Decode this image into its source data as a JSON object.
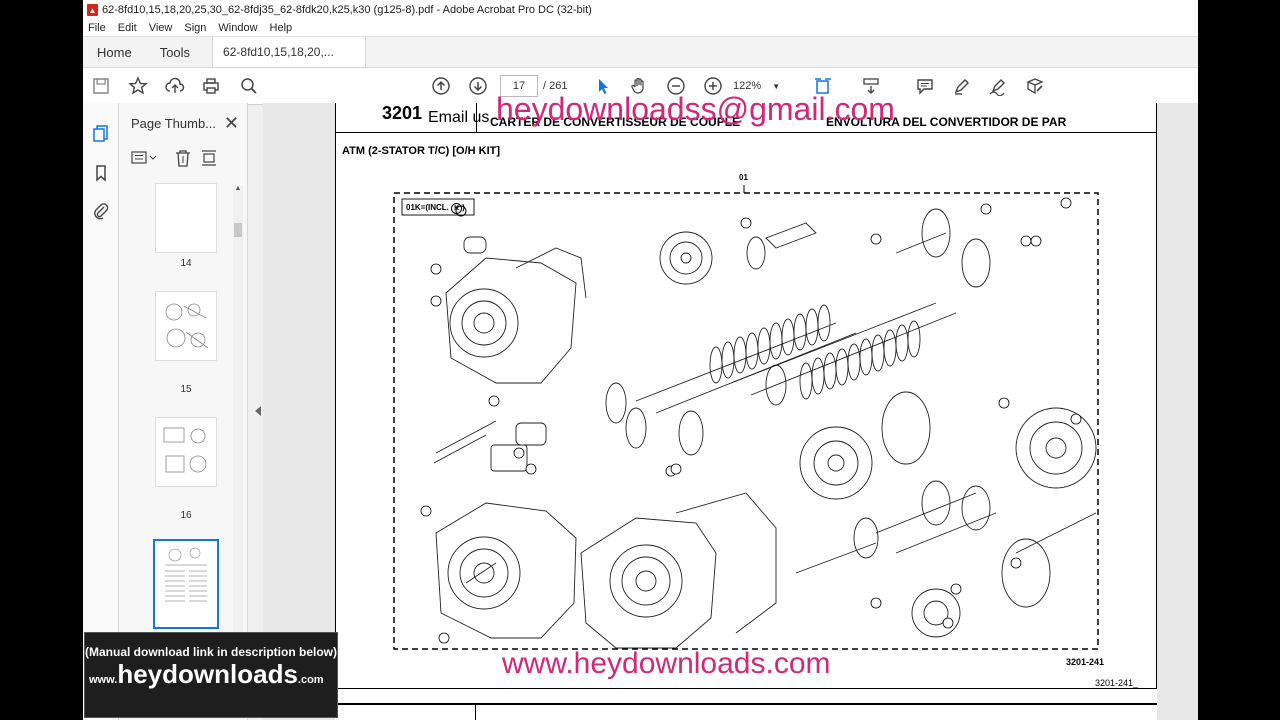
{
  "window": {
    "title": "62-8fd10,15,18,20,25,30_62-8fdj35_62-8fdk20,k25,k30 (g125-8).pdf - Adobe Acrobat Pro DC (32-bit)",
    "app_icon": "acrobat-pdf-icon"
  },
  "menu": [
    "File",
    "Edit",
    "View",
    "Sign",
    "Window",
    "Help"
  ],
  "tabs": {
    "home": "Home",
    "tools": "Tools",
    "document": "62-8fd10,15,18,20,..."
  },
  "toolbar": {
    "current_page": "17",
    "total_pages": "/ 261",
    "zoom": "122%"
  },
  "thumbnails": {
    "panel_title": "Page Thumb...",
    "pages": [
      "14",
      "15",
      "16"
    ]
  },
  "document": {
    "section_number": "3201",
    "header_fr": "CARTER DE CONVERTISSEUR DE COUPLE",
    "header_es": "ENVOLTURA DEL CONVERTIDOR DE PAR",
    "email_prefix": "Email us",
    "figure_title": "ATM (2-STATOR T/C) [O/H KIT]",
    "kit_label": "01K=(INCL.",
    "kit_symbol": "K",
    "part_top_label": "01",
    "figure_code": "3201-241",
    "page_code": "3201-241_",
    "watermark_email": "heydownloadss@gmail.com",
    "watermark_url": "www.heydownloads.com"
  },
  "promo": {
    "line1": "(Manual download link in description below)",
    "prefix": "www.",
    "main": "heydownloads",
    "suffix": ".com"
  },
  "colors": {
    "watermark": "#d0287a",
    "acrobat_red": "#d9241c",
    "toolbar_blue": "#1473e6"
  }
}
